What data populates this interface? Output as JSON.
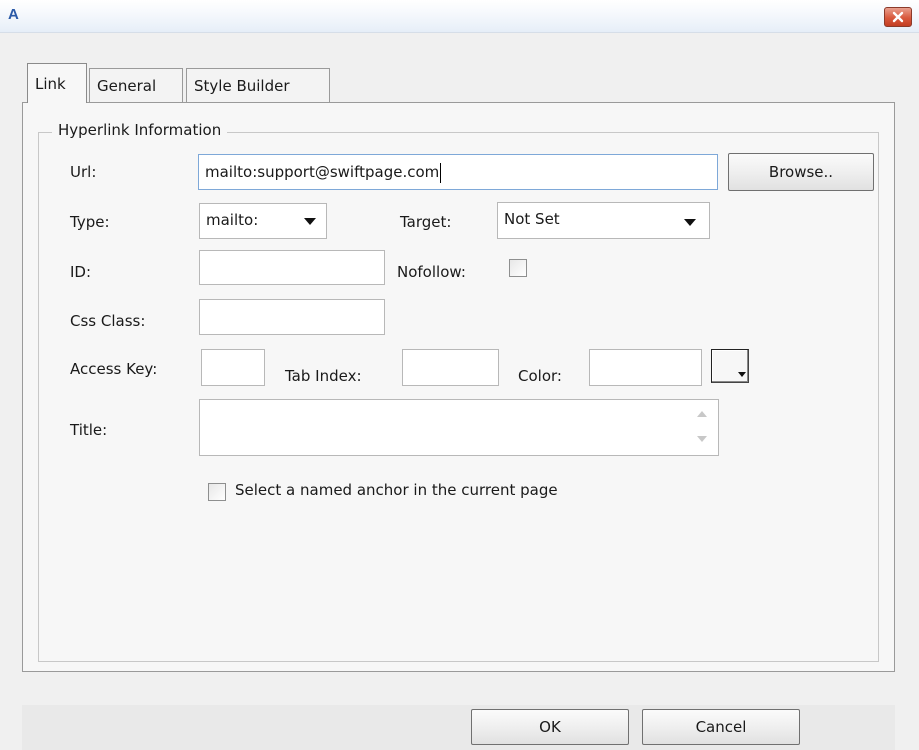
{
  "window": {
    "title_icon": "A",
    "close_icon": "close-icon"
  },
  "tabs": [
    {
      "label": "Link",
      "active": true
    },
    {
      "label": "General",
      "active": false
    },
    {
      "label": "Style Builder",
      "active": false
    }
  ],
  "group": {
    "legend": "Hyperlink Information"
  },
  "url": {
    "label": "Url:",
    "value": "mailto:support@swiftpage.com",
    "browse_label": "Browse.."
  },
  "type": {
    "label": "Type:",
    "value": "mailto:"
  },
  "target": {
    "label": "Target:",
    "value": "Not Set"
  },
  "id": {
    "label": "ID:",
    "value": ""
  },
  "nofollow": {
    "label": "Nofollow:",
    "checked": false
  },
  "css_class": {
    "label": "Css Class:",
    "value": ""
  },
  "access_key": {
    "label": "Access Key:",
    "value": ""
  },
  "tab_index": {
    "label": "Tab Index:",
    "value": ""
  },
  "color": {
    "label": "Color:",
    "value": "",
    "picker_icon": "color-picker-icon"
  },
  "title_field": {
    "label": "Title:",
    "value": ""
  },
  "anchor": {
    "label": "Select a named anchor in the current page",
    "checked": false
  },
  "buttons": {
    "ok": "OK",
    "cancel": "Cancel"
  }
}
